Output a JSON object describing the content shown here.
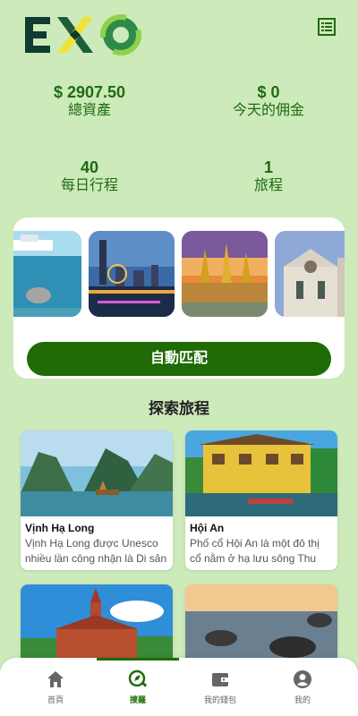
{
  "brand": {
    "logo_text": "EXO"
  },
  "stats": [
    {
      "value": "$ 2907.50",
      "label": "總資產"
    },
    {
      "value": "$ 0",
      "label": "今天的佣金"
    },
    {
      "value": "40",
      "label": "每日行程"
    },
    {
      "value": "1",
      "label": "旅程"
    }
  ],
  "match_button": "自動匹配",
  "explore_title": "探索旅程",
  "tours": [
    {
      "name": "Vịnh Hạ Long",
      "desc": "Vịnh Hạ Long được Unesco nhiều lần công nhận là Di sản thiên nhiên thế giới"
    },
    {
      "name": "Hội An",
      "desc": "Phố cổ Hội An là một đô thị cổ nằm ở hạ lưu sông Thu Bồn"
    },
    {
      "name": "",
      "desc": ""
    },
    {
      "name": "",
      "desc": ""
    }
  ],
  "nav": [
    {
      "label": "首頁",
      "icon": "home-icon"
    },
    {
      "label": "搜羅",
      "icon": "explore-icon"
    },
    {
      "label": "我的錢包",
      "icon": "wallet-icon"
    },
    {
      "label": "我的",
      "icon": "profile-icon"
    }
  ],
  "colors": {
    "accent": "#1f6b05",
    "background": "#cdeabb",
    "stat_text": "#1f6b12"
  }
}
